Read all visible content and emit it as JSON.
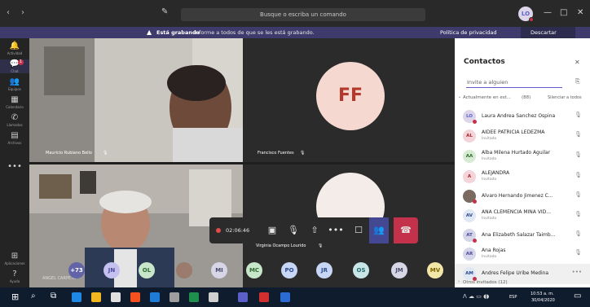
{
  "titlebar": {
    "back": "‹",
    "forward": "›",
    "compose_icon": "compose-icon",
    "search_placeholder": "Busque o escriba un comando",
    "avatar_initials": "LO",
    "minimize": "—",
    "maximize": "□",
    "close": "✕"
  },
  "banner": {
    "bold": "Está grabando",
    "text": "Informe a todos de que se les está grabando.",
    "privacy_button": "Política de privacidad",
    "dismiss_button": "Descartar"
  },
  "rail": [
    {
      "icon": "bell-icon",
      "glyph": "🔔",
      "label": "Actividad"
    },
    {
      "icon": "chat-icon",
      "glyph": "💬",
      "label": "Chat",
      "badge": "1"
    },
    {
      "icon": "teams-icon",
      "glyph": "👥",
      "label": "Equipos"
    },
    {
      "icon": "calendar-icon",
      "glyph": "▦",
      "label": "Calendario"
    },
    {
      "icon": "phone-icon",
      "glyph": "✆",
      "label": "Llamadas"
    },
    {
      "icon": "files-icon",
      "glyph": "▤",
      "label": "Archivos"
    },
    {
      "icon": "more-icon",
      "glyph": "•••",
      "label": ""
    }
  ],
  "rail_bottom": [
    {
      "icon": "apps-icon",
      "glyph": "⊞",
      "label": "Aplicaciones"
    },
    {
      "icon": "help-icon",
      "glyph": "?",
      "label": "Ayuda"
    }
  ],
  "tiles": {
    "t1_name": "Mauricio Rubiano Bello",
    "t2_name": "Francisco Fuentes",
    "t2_initials": "FF",
    "t3_name": "ANGEL CARPETA",
    "t4_name": "Virginia Ocampo Lourido"
  },
  "controls": {
    "rec_time": "02:06:46",
    "camera_icon": "camera-off-icon",
    "mic_icon": "mic-off-icon",
    "share_icon": "share-screen-icon",
    "more_icon": "more-actions-icon",
    "chat_icon": "chat-toggle-icon",
    "participants_icon": "participants-icon",
    "hangup_icon": "hang-up-icon"
  },
  "participant_strip": [
    {
      "initials": "+73",
      "color": "#6264a7",
      "fg": "#ffffff"
    },
    {
      "initials": "JN",
      "color": "#c4c0f0",
      "fg": "#4a4a9c"
    },
    {
      "initials": "OL",
      "color": "#c8e6c9",
      "fg": "#2e6b30"
    },
    {
      "initials": "",
      "color": "#9a7b6e",
      "fg": "#ffffff"
    },
    {
      "initials": "MI",
      "color": "#d6d6e6",
      "fg": "#4a4a6c"
    },
    {
      "initials": "MC",
      "color": "#c8e6c9",
      "fg": "#2e6b30"
    },
    {
      "initials": "PO",
      "color": "#c8d6f5",
      "fg": "#2c4a8c"
    },
    {
      "initials": "JR",
      "color": "#c8d6f5",
      "fg": "#2c4a8c"
    },
    {
      "initials": "OS",
      "color": "#c8e6e8",
      "fg": "#276b6f"
    },
    {
      "initials": "JM",
      "color": "#d6d6e6",
      "fg": "#4a4a6c"
    },
    {
      "initials": "MV",
      "color": "#f3e6a9",
      "fg": "#7a6200"
    }
  ],
  "panel": {
    "title": "Contactos",
    "close": "✕",
    "invite_placeholder": "Invite a alguien",
    "section": "Actualmente en est...",
    "section_count": "(88)",
    "mute_all": "Silenciar a todos",
    "contacts": [
      {
        "initials": "LO",
        "name": "Laura Andrea Sanchez Ospina",
        "sub": "",
        "color": "#ddd6ea",
        "fg": "#5b5fc7",
        "status": "red",
        "action": "🎙"
      },
      {
        "initials": "AL",
        "name": "AIDEE PATRICIA LEDEZMA",
        "sub": "Invitado",
        "color": "#f4d3d9",
        "fg": "#a4262c",
        "status": "",
        "action": "🎙"
      },
      {
        "initials": "AA",
        "name": "Alba Milena Hurtado Aguilar",
        "sub": "Invitado",
        "color": "#d6ebd2",
        "fg": "#2e6b30",
        "status": "",
        "action": "🎙"
      },
      {
        "initials": "A",
        "name": "ALEJANDRA",
        "sub": "Invitado",
        "color": "#f4d3d9",
        "fg": "#a4262c",
        "status": "",
        "action": "🎙"
      },
      {
        "initials": "",
        "name": "Alvaro Hernando Jimenez C...",
        "sub": "",
        "color": "#7b6a60",
        "fg": "#ffffff",
        "status": "red",
        "action": "🎙"
      },
      {
        "initials": "AV",
        "name": "ANA CLEMENCIA MINA VID...",
        "sub": "Invitado",
        "color": "#e0e7f5",
        "fg": "#2c4a8c",
        "status": "",
        "action": "🎙"
      },
      {
        "initials": "AT",
        "name": "Ana Elizabeth Salazar Taimb...",
        "sub": "",
        "color": "#d6d6ea",
        "fg": "#4a4a9c",
        "status": "red",
        "action": "🎙"
      },
      {
        "initials": "AR",
        "name": "Ana Rojas",
        "sub": "Invitado",
        "color": "#d6d6ea",
        "fg": "#4a4a9c",
        "status": "",
        "action": "🎙"
      },
      {
        "initials": "AM",
        "name": "Andres Felipe Uribe Medina",
        "sub": "",
        "color": "#e0e7f5",
        "fg": "#2c4a8c",
        "status": "red",
        "action": "•••"
      }
    ],
    "others": "Otros invitados (12)"
  },
  "taskbar": {
    "lang": "ESP",
    "time": "10:53 a. m.",
    "date": "30/04/2020"
  }
}
